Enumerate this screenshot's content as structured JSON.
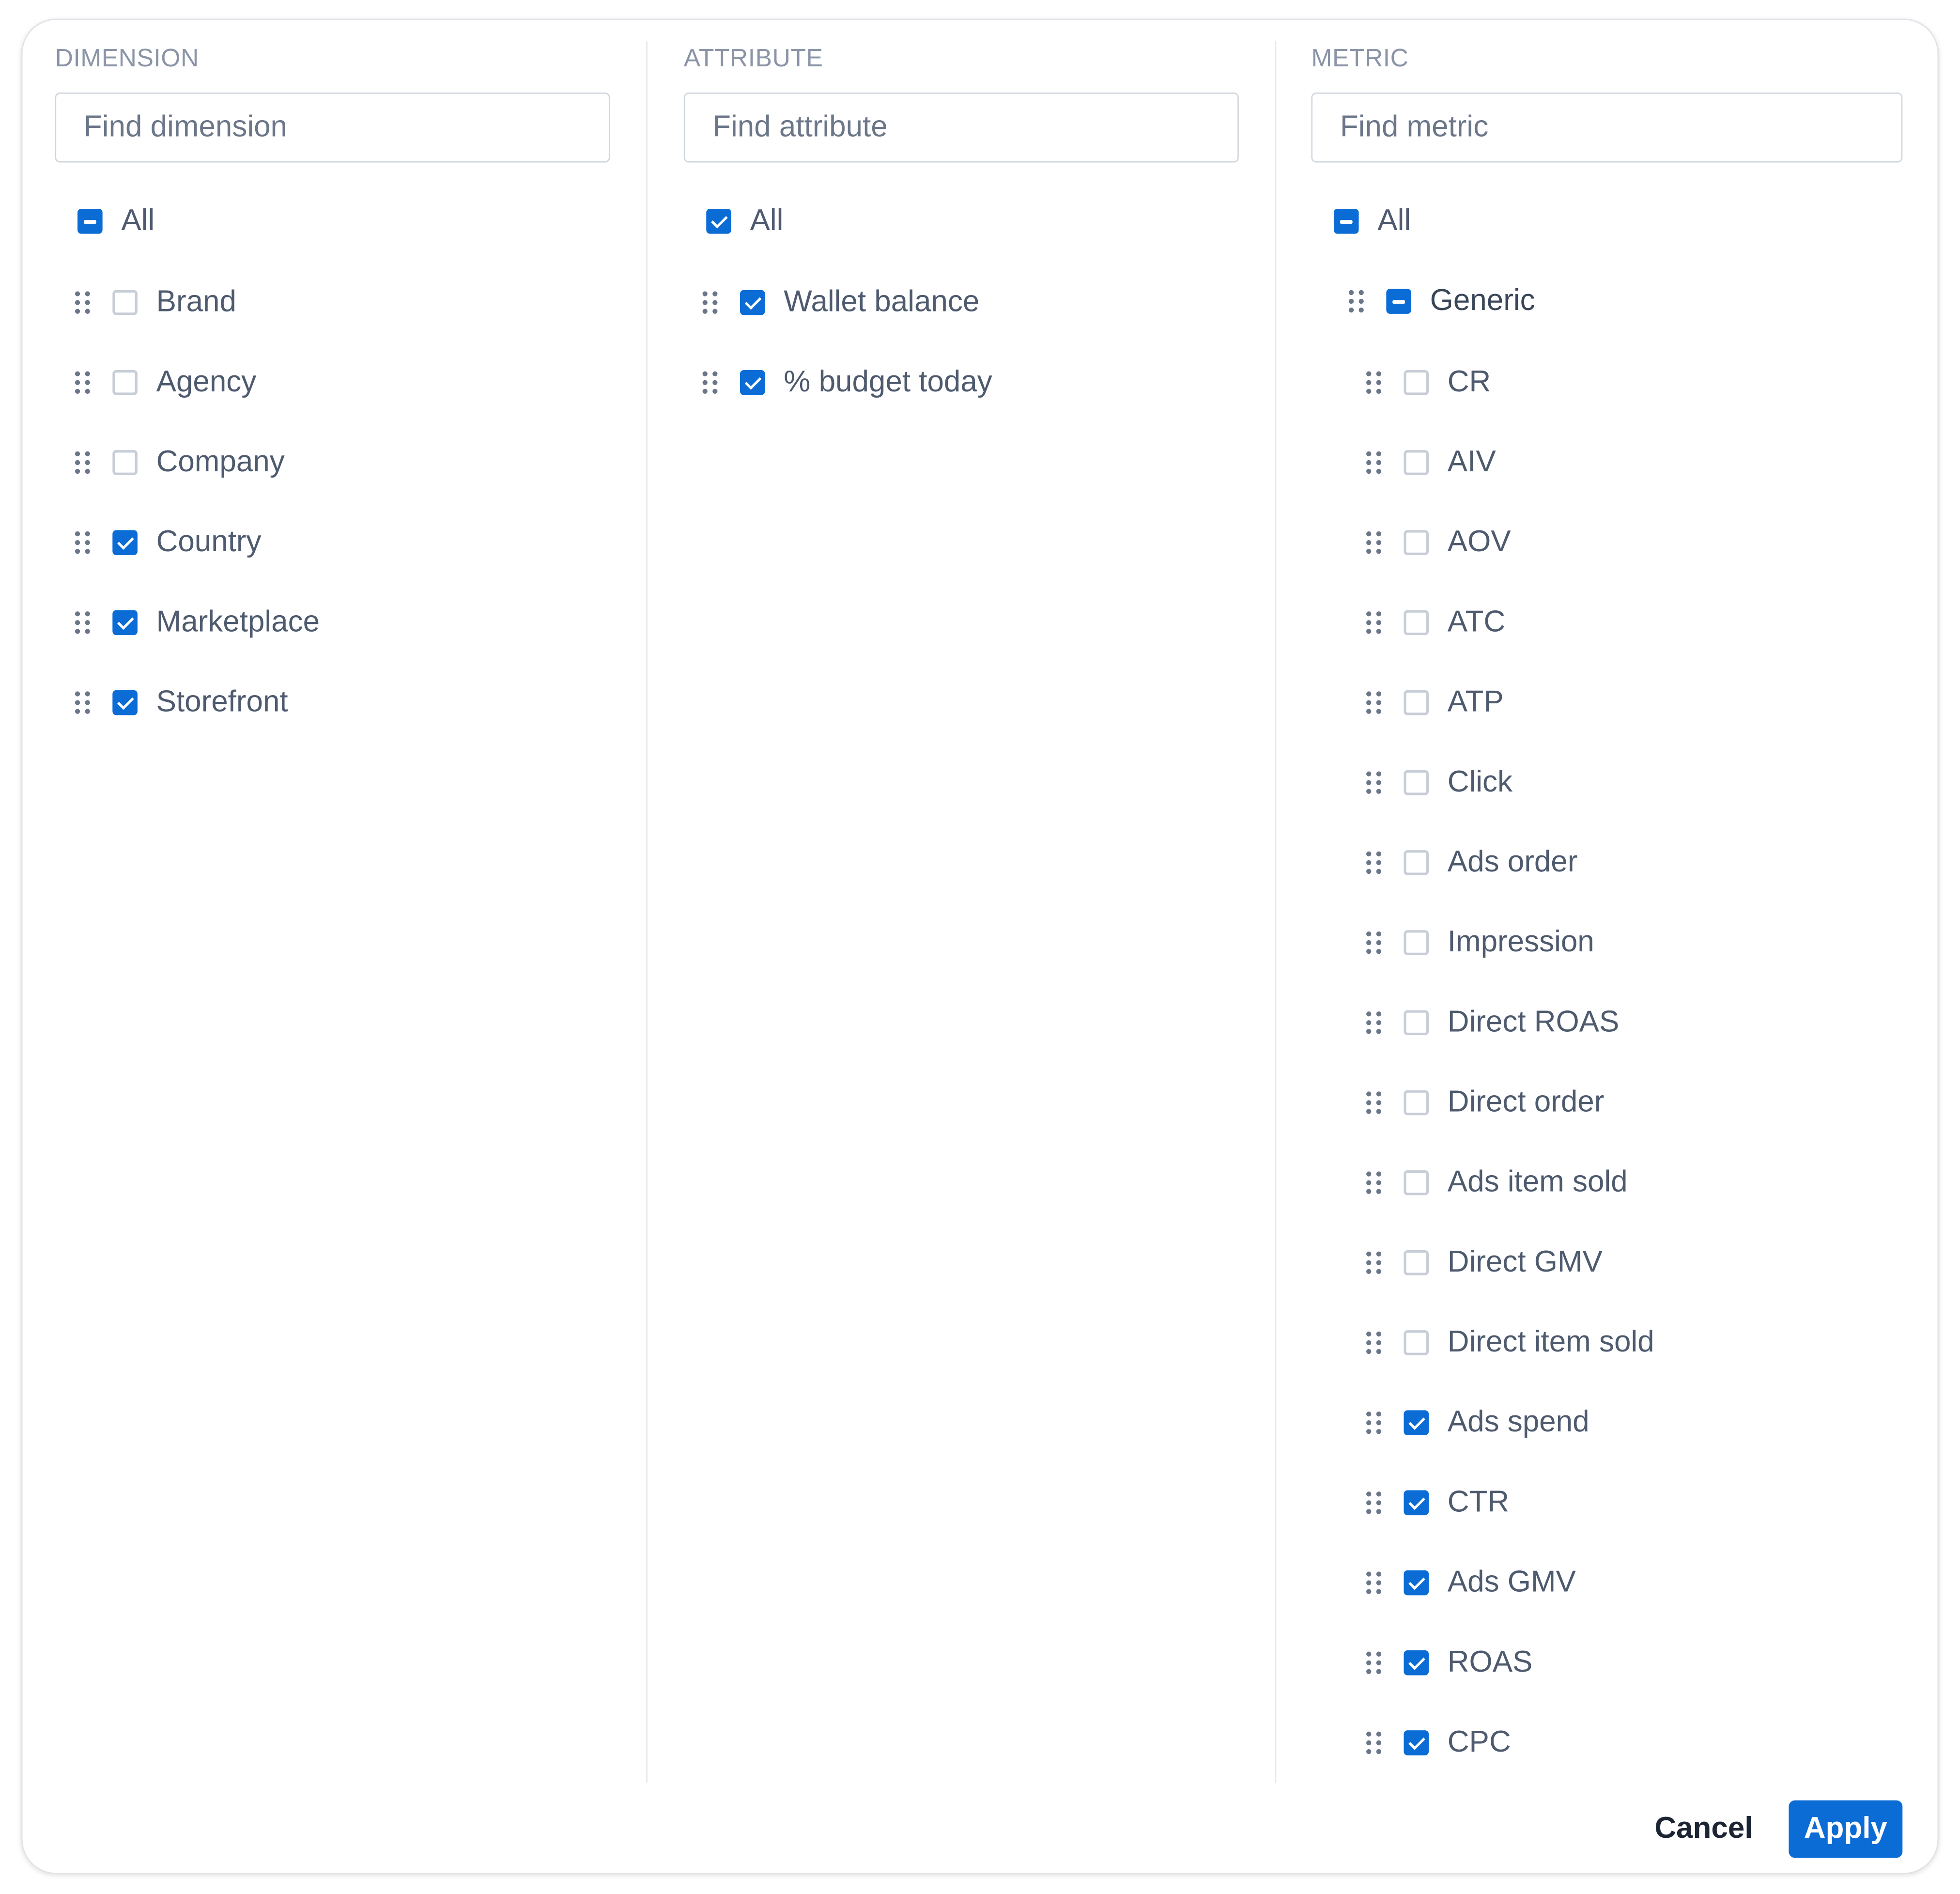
{
  "dimension": {
    "title": "DIMENSION",
    "placeholder": "Find dimension",
    "all_label": "All",
    "all_state": "mixed",
    "items": [
      {
        "label": "Brand",
        "checked": false
      },
      {
        "label": "Agency",
        "checked": false
      },
      {
        "label": "Company",
        "checked": false
      },
      {
        "label": "Country",
        "checked": true
      },
      {
        "label": "Marketplace",
        "checked": true
      },
      {
        "label": "Storefront",
        "checked": true
      }
    ]
  },
  "attribute": {
    "title": "ATTRIBUTE",
    "placeholder": "Find attribute",
    "all_label": "All",
    "all_state": "checked",
    "items": [
      {
        "label": "Wallet balance",
        "checked": true
      },
      {
        "label": "% budget today",
        "checked": true
      }
    ]
  },
  "metric": {
    "title": "METRIC",
    "placeholder": "Find metric",
    "all_label": "All",
    "all_state": "mixed",
    "group": {
      "label": "Generic",
      "state": "mixed"
    },
    "items": [
      {
        "label": "CR",
        "checked": false
      },
      {
        "label": "AIV",
        "checked": false
      },
      {
        "label": "AOV",
        "checked": false
      },
      {
        "label": "ATC",
        "checked": false
      },
      {
        "label": "ATP",
        "checked": false
      },
      {
        "label": "Click",
        "checked": false
      },
      {
        "label": "Ads order",
        "checked": false
      },
      {
        "label": "Impression",
        "checked": false
      },
      {
        "label": "Direct ROAS",
        "checked": false
      },
      {
        "label": "Direct order",
        "checked": false
      },
      {
        "label": "Ads item sold",
        "checked": false
      },
      {
        "label": "Direct GMV",
        "checked": false
      },
      {
        "label": "Direct item sold",
        "checked": false
      },
      {
        "label": "Ads spend",
        "checked": true
      },
      {
        "label": "CTR",
        "checked": true
      },
      {
        "label": "Ads GMV",
        "checked": true
      },
      {
        "label": "ROAS",
        "checked": true
      },
      {
        "label": "CPC",
        "checked": true
      }
    ]
  },
  "footer": {
    "cancel_label": "Cancel",
    "apply_label": "Apply"
  },
  "colors": {
    "accent": "#0b6cd6",
    "text": "#4e5a6e",
    "muted": "#8a94a6"
  }
}
